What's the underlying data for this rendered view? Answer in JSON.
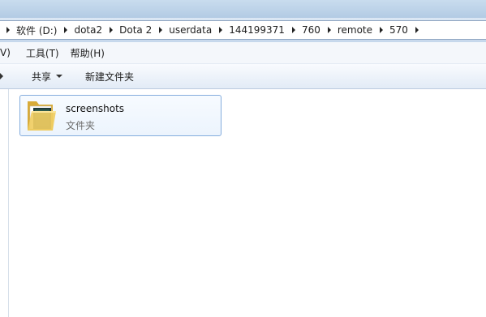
{
  "window": {
    "title": ""
  },
  "address": {
    "crumbs": [
      "软件 (D:)",
      "dota2",
      "Dota 2",
      "userdata",
      "144199371",
      "760",
      "remote",
      "570"
    ]
  },
  "menu": {
    "items": [
      "V)",
      "工具(T)",
      "帮助(H)"
    ]
  },
  "commands": {
    "share": "共享",
    "new_folder": "新建文件夹"
  },
  "items": [
    {
      "name": "screenshots",
      "type": "文件夹",
      "icon": "folder-icon"
    }
  ],
  "colors": {
    "selection_border": "#84acdd",
    "folder_yellow": "#e8c25a"
  }
}
